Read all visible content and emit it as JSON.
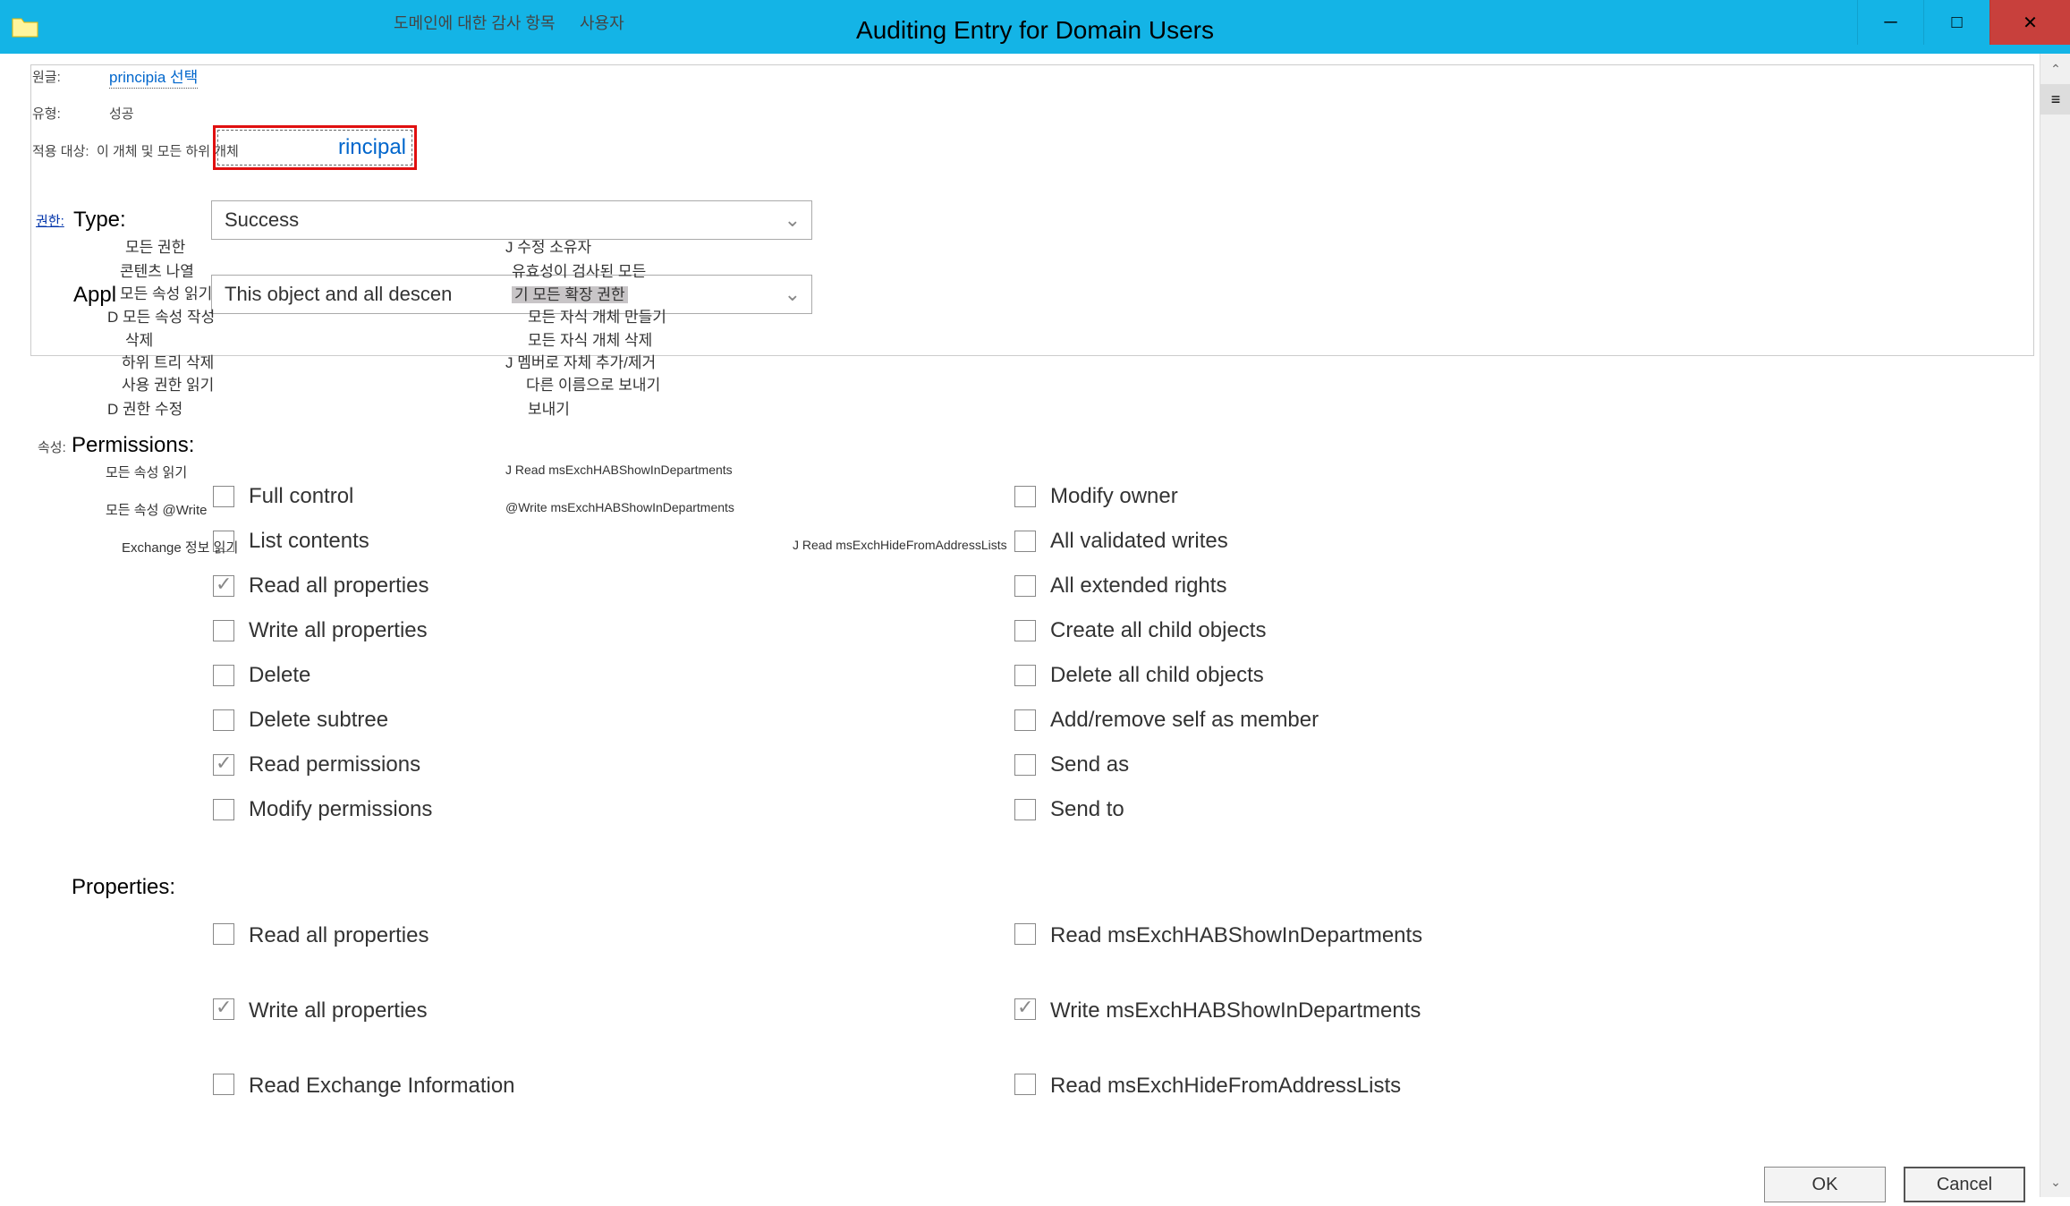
{
  "title": {
    "main": "Auditing Entry for Domain Users",
    "sub_ko": "도메인에 대한 감사 항목",
    "sub_user": "사용자"
  },
  "win": {
    "min": "–",
    "max": "☐",
    "close": "✕"
  },
  "header": {
    "principal_lbl": "원글:",
    "principal_link": "principia 선택",
    "type_lbl_ko": "유형:",
    "type_lbl": "Type:",
    "type_val": "Success",
    "type_val_ko": "성공",
    "applies_lbl_ko": "적용 대상:",
    "applies_hint_ko": "이 개체 및 모든 하위 개체",
    "applies_lbl": "Appl",
    "applies_val": "This object and all descen",
    "principal_boxtext": "rincipal",
    "perm_link_ko": "권한:"
  },
  "ghost": {
    "c1": [
      "모든 권한",
      "콘텐츠 나열",
      "모든 속성 읽기",
      "D 모든 속성 작성",
      "삭제",
      "하위 트리 삭제",
      "사용 권한 읽기",
      "D 권한 수정"
    ],
    "c2": [
      "J 수정 소유자",
      "유효성이 검사된 모든",
      "기 모든 확장 권한",
      "모든 자식 개체 만들기",
      "모든 자식 개체 삭제",
      "J 멤버로 자체 추가/제거",
      "다른 이름으로 보내기",
      "보내기"
    ],
    "attr_lbl": "속성:",
    "a1": [
      "모든 속성 읽기",
      "모든 속성 @Write",
      "Exchange 정보 읽기"
    ],
    "a2": [
      "J Read msExchHABShowInDepartments",
      "@Write msExchHABShowInDepartments",
      "J Read msExchHideFromAddressLists"
    ]
  },
  "perm": {
    "hdr": "Permissions:",
    "left": [
      {
        "label": "Full control",
        "checked": false
      },
      {
        "label": "List contents",
        "checked": false
      },
      {
        "label": "Read all properties",
        "checked": true
      },
      {
        "label": "Write all properties",
        "checked": false
      },
      {
        "label": "Delete",
        "checked": false
      },
      {
        "label": "Delete subtree",
        "checked": false
      },
      {
        "label": "Read permissions",
        "checked": true
      },
      {
        "label": "Modify permissions",
        "checked": false
      }
    ],
    "right": [
      {
        "label": "Modify owner",
        "checked": false
      },
      {
        "label": "All validated writes",
        "checked": false
      },
      {
        "label": "All extended rights",
        "checked": false
      },
      {
        "label": "Create all child objects",
        "checked": false
      },
      {
        "label": "Delete all child objects",
        "checked": false
      },
      {
        "label": "Add/remove self as member",
        "checked": false
      },
      {
        "label": "Send as",
        "checked": false
      },
      {
        "label": "Send to",
        "checked": false
      }
    ]
  },
  "props": {
    "hdr": "Properties:",
    "left": [
      {
        "label": "Read all properties",
        "checked": false
      },
      {
        "label": "Write all properties",
        "checked": true
      },
      {
        "label": "Read Exchange Information",
        "checked": false
      }
    ],
    "right": [
      {
        "label": "Read msExchHABShowInDepartments",
        "checked": false
      },
      {
        "label": "Write msExchHABShowInDepartments",
        "checked": true
      },
      {
        "label": "Read msExchHideFromAddressLists",
        "checked": false
      }
    ]
  },
  "buttons": {
    "ok": "OK",
    "cancel": "Cancel"
  }
}
